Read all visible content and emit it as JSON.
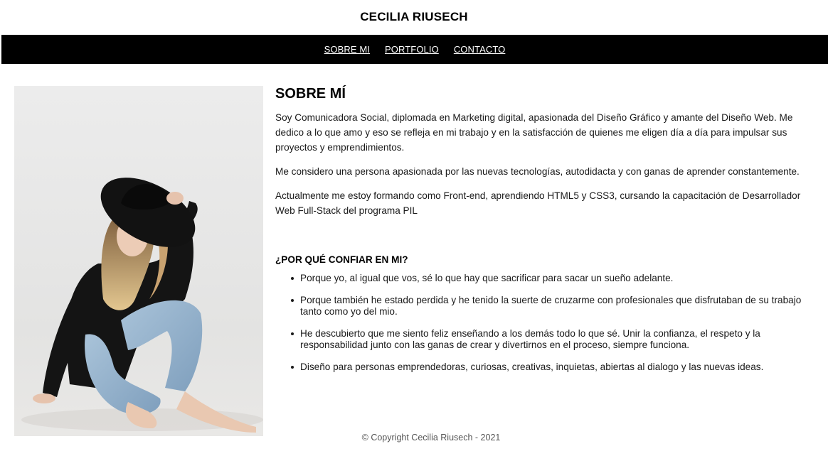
{
  "header": {
    "site_title": "CECILIA RIUSECH"
  },
  "nav": {
    "items": [
      {
        "label": "SOBRE MI"
      },
      {
        "label": "PORTFOLIO"
      },
      {
        "label": "CONTACTO"
      }
    ]
  },
  "about": {
    "heading": "SOBRE MÍ",
    "paragraphs": [
      "Soy Comunicadora Social, diplomada en Marketing digital, apasionada del Diseño Gráfico y amante del Diseño Web. Me dedico a lo que amo y eso se refleja en mi trabajo y en la satisfacción de quienes me eligen día a día para impulsar sus proyectos y emprendimientos.",
      "Me considero una persona apasionada por las nuevas tecnologías, autodidacta y con ganas de aprender constantemente.",
      "Actualmente me estoy formando como Front-end, aprendiendo HTML5 y CSS3, cursando la capacitación de Desarrollador Web Full-Stack del programa PIL"
    ]
  },
  "why": {
    "heading": "¿POR QUÉ CONFIAR EN MI?",
    "reasons": [
      "Porque yo, al igual que vos, sé lo que hay que sacrificar para sacar un sueño adelante.",
      "Porque también he estado perdida y he tenido la suerte de cruzarme con profesionales que disfrutaban de su trabajo tanto como yo del mio.",
      "He descubierto que me siento feliz enseñando a los demás todo lo que sé. Unir la confianza, el respeto y la responsabilidad junto con las ganas de crear y divertirnos en el proceso, siempre funciona.",
      "Diseño para personas emprendedoras, curiosas, creativas, inquietas, abiertas al dialogo y las nuevas ideas."
    ]
  },
  "footer": {
    "copyright": "© Copyright Cecilia Riusech - 2021"
  },
  "colors": {
    "nav_background": "#000000",
    "nav_text": "#ffffff",
    "page_background": "#ffffff",
    "footer_text": "#555555"
  }
}
